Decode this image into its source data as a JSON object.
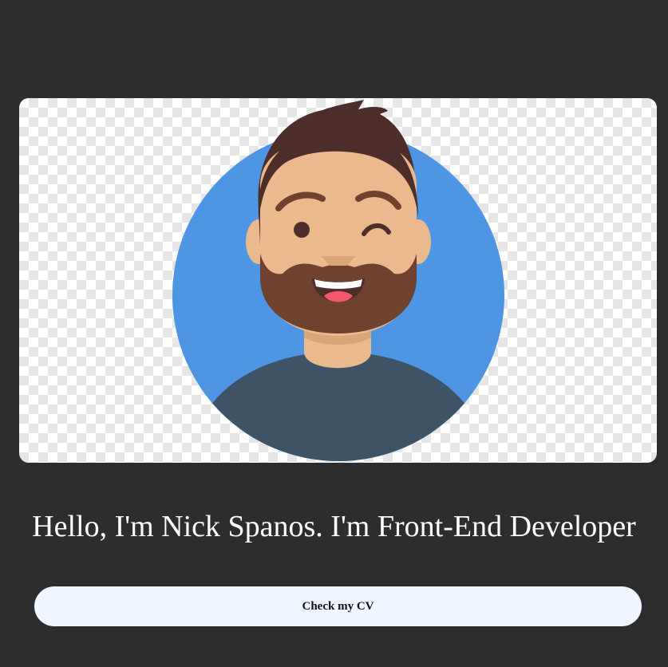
{
  "hero": {
    "headline": "Hello, I'm Nick Spanos. I'm Front-End Developer",
    "avatar_icon": "developer-avatar-illustration",
    "colors": {
      "page_background": "#2d2d2d",
      "avatar_circle": "#4e96e4",
      "skin": "#eab98d",
      "hair_beard": "#4d2e2b",
      "shirt": "#3e5466"
    }
  },
  "cta": {
    "cv_button_label": "Check my CV",
    "background": "#f0f6ff"
  }
}
